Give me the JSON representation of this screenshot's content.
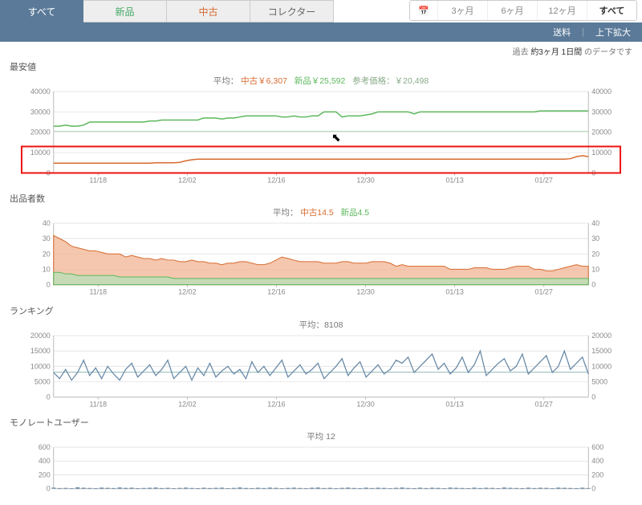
{
  "tabs": {
    "all": "すべて",
    "new": "新品",
    "used": "中古",
    "collector": "コレクター"
  },
  "range": {
    "m3": "3ヶ月",
    "m6": "6ヶ月",
    "m12": "12ヶ月",
    "all": "すべて"
  },
  "subbar": {
    "ship": "送料",
    "expand": "上下拡大"
  },
  "meta_prefix": "過去 ",
  "meta_period": "約3ヶ月 1日間",
  "meta_suffix": " のデータです",
  "x_ticks": [
    "11/18",
    "12/02",
    "12/16",
    "12/30",
    "01/13",
    "01/27"
  ],
  "charts": {
    "price": {
      "title": "最安値",
      "avg_label": "平均：",
      "used_lbl": "中古",
      "used_val": "￥6,307",
      "new_lbl": "新品",
      "new_val": "￥25,592",
      "ref_lbl": "参考価格：",
      "ref_val": "￥20,498",
      "y_ticks": [
        "0",
        "10000",
        "20000",
        "30000",
        "40000"
      ]
    },
    "sellers": {
      "title": "出品者数",
      "avg_label": "平均：",
      "used_lbl": "中古",
      "used_val": "14.5",
      "new_lbl": "新品",
      "new_val": "4.5",
      "y_ticks": [
        "0",
        "10",
        "20",
        "30",
        "40"
      ]
    },
    "rank": {
      "title": "ランキング",
      "avg_label": "平均：",
      "avg_val": "8108",
      "y_ticks": [
        "0",
        "5000",
        "10000",
        "15000",
        "20000"
      ]
    },
    "users": {
      "title": "モノレートユーザー",
      "avg_label": "平均",
      "avg_val": "12",
      "y_ticks": [
        "0",
        "200",
        "400",
        "600"
      ]
    }
  },
  "chart_data": [
    {
      "type": "line",
      "title": "最安値",
      "x": [
        0,
        1,
        2,
        3,
        4,
        5,
        6,
        7,
        8,
        9,
        10,
        11,
        12,
        13,
        14,
        15,
        16,
        17,
        18,
        19,
        20,
        21,
        22,
        23,
        24,
        25,
        26,
        27,
        28,
        29,
        30,
        31,
        32,
        33,
        34,
        35,
        36,
        37,
        38,
        39,
        40,
        41,
        42,
        43,
        44,
        45,
        46,
        47,
        48,
        49,
        50,
        51,
        52,
        53,
        54,
        55,
        56,
        57,
        58,
        59,
        60,
        61,
        62,
        63,
        64,
        65,
        66,
        67,
        68,
        69,
        70,
        71,
        72,
        73,
        74,
        75,
        76,
        77,
        78,
        79,
        80,
        81,
        82,
        83,
        84,
        85,
        86,
        87,
        88,
        89
      ],
      "x_tick_labels": [
        "11/18",
        "12/02",
        "12/16",
        "12/30",
        "01/13",
        "01/27"
      ],
      "ylim": [
        0,
        40000
      ],
      "series": [
        {
          "name": "新品",
          "color": "#5cb85c",
          "values": [
            23000,
            23000,
            23500,
            23000,
            23000,
            23500,
            25000,
            25000,
            25000,
            25000,
            25000,
            25000,
            25000,
            25000,
            25000,
            25000,
            25500,
            25500,
            26000,
            26000,
            26000,
            26000,
            26000,
            26000,
            26000,
            27000,
            27000,
            27000,
            26500,
            27000,
            27000,
            27500,
            28000,
            28000,
            28000,
            28000,
            28000,
            28000,
            27500,
            27500,
            28000,
            27500,
            27500,
            28000,
            28000,
            30000,
            30000,
            30000,
            27500,
            28000,
            28000,
            28000,
            28500,
            29000,
            30000,
            30000,
            30000,
            30000,
            30000,
            30000,
            29000,
            30000,
            30000,
            30000,
            30000,
            30000,
            30000,
            30000,
            30000,
            30000,
            30000,
            30000,
            30000,
            30000,
            30000,
            30000,
            30000,
            30000,
            30000,
            30000,
            30000,
            30500,
            30500,
            30500,
            30500,
            30500,
            30500,
            30500,
            30500,
            30500
          ]
        },
        {
          "name": "中古",
          "color": "#d86a2f",
          "values": [
            4800,
            4800,
            4800,
            4800,
            4800,
            4800,
            4800,
            4800,
            4800,
            4800,
            4800,
            4800,
            4800,
            4800,
            4800,
            4800,
            4800,
            5000,
            5000,
            5000,
            5000,
            5200,
            6000,
            6500,
            6800,
            6800,
            6800,
            6800,
            6800,
            6800,
            6800,
            6800,
            6800,
            6800,
            6800,
            6800,
            6800,
            6800,
            6800,
            6800,
            6800,
            6800,
            6800,
            6800,
            6800,
            6800,
            6800,
            6800,
            6800,
            6800,
            6800,
            6800,
            6800,
            6800,
            6800,
            6800,
            6800,
            6800,
            6800,
            6800,
            6800,
            6800,
            6800,
            6800,
            6800,
            6800,
            6800,
            6800,
            6800,
            6800,
            6800,
            6800,
            6800,
            6800,
            6800,
            6800,
            6800,
            6800,
            6800,
            6800,
            6800,
            6800,
            6800,
            6800,
            6800,
            6800,
            7000,
            8000,
            8500,
            8000
          ]
        },
        {
          "name": "参考価格",
          "color": "#9c9",
          "values": [
            20498,
            20498,
            20498,
            20498,
            20498,
            20498,
            20498,
            20498,
            20498,
            20498,
            20498,
            20498,
            20498,
            20498,
            20498,
            20498,
            20498,
            20498,
            20498,
            20498,
            20498,
            20498,
            20498,
            20498,
            20498,
            20498,
            20498,
            20498,
            20498,
            20498,
            20498,
            20498,
            20498,
            20498,
            20498,
            20498,
            20498,
            20498,
            20498,
            20498,
            20498,
            20498,
            20498,
            20498,
            20498,
            20498,
            20498,
            20498,
            20498,
            20498,
            20498,
            20498,
            20498,
            20498,
            20498,
            20498,
            20498,
            20498,
            20498,
            20498,
            20498,
            20498,
            20498,
            20498,
            20498,
            20498,
            20498,
            20498,
            20498,
            20498,
            20498,
            20498,
            20498,
            20498,
            20498,
            20498,
            20498,
            20498,
            20498,
            20498,
            20498,
            20498,
            20498,
            20498,
            20498,
            20498,
            20498,
            20498,
            20498,
            20498
          ]
        }
      ]
    },
    {
      "type": "area",
      "title": "出品者数",
      "x_tick_labels": [
        "11/18",
        "12/02",
        "12/16",
        "12/30",
        "01/13",
        "01/27"
      ],
      "ylim": [
        0,
        40
      ],
      "series": [
        {
          "name": "中古",
          "color": "#e8a07a",
          "values": [
            32,
            30,
            28,
            25,
            24,
            23,
            22,
            22,
            21,
            20,
            20,
            20,
            18,
            19,
            18,
            17,
            17,
            16,
            17,
            16,
            16,
            15,
            15,
            16,
            15,
            15,
            14,
            14,
            13,
            14,
            14,
            15,
            15,
            14,
            13,
            13,
            14,
            16,
            18,
            17,
            16,
            15,
            15,
            15,
            15,
            14,
            14,
            14,
            15,
            15,
            14,
            14,
            14,
            15,
            15,
            15,
            14,
            12,
            13,
            12,
            12,
            12,
            12,
            12,
            12,
            12,
            10,
            10,
            10,
            10,
            11,
            11,
            11,
            10,
            10,
            10,
            11,
            12,
            12,
            12,
            10,
            10,
            9,
            9,
            10,
            11,
            12,
            13,
            12,
            12
          ]
        },
        {
          "name": "新品",
          "color": "#9ed29e",
          "values": [
            8,
            8,
            7,
            7,
            6,
            6,
            6,
            6,
            6,
            6,
            6,
            5,
            5,
            5,
            5,
            5,
            5,
            5,
            5,
            5,
            4,
            4,
            4,
            4,
            4,
            4,
            4,
            4,
            4,
            4,
            4,
            4,
            4,
            4,
            4,
            4,
            4,
            4,
            4,
            4,
            4,
            4,
            4,
            4,
            4,
            4,
            4,
            4,
            4,
            4,
            4,
            4,
            4,
            4,
            4,
            4,
            4,
            4,
            4,
            4,
            4,
            4,
            4,
            4,
            4,
            4,
            4,
            4,
            4,
            4,
            4,
            4,
            4,
            4,
            4,
            4,
            4,
            4,
            4,
            4,
            4,
            4,
            4,
            4,
            4,
            4,
            4,
            4,
            4,
            4
          ]
        }
      ]
    },
    {
      "type": "line",
      "title": "ランキング",
      "x_tick_labels": [
        "11/18",
        "12/02",
        "12/16",
        "12/30",
        "01/13",
        "01/27"
      ],
      "ylim": [
        0,
        20000
      ],
      "series": [
        {
          "name": "rank",
          "color": "#6a8ba8",
          "values": [
            8000,
            6000,
            9000,
            5500,
            8000,
            12000,
            7000,
            9500,
            6000,
            10000,
            7500,
            5500,
            9000,
            11000,
            6500,
            8500,
            10500,
            7000,
            9000,
            12000,
            6000,
            8000,
            10000,
            5500,
            9500,
            7000,
            11000,
            6500,
            8500,
            10000,
            7500,
            9000,
            6000,
            11500,
            8000,
            10000,
            7000,
            9500,
            12000,
            6500,
            8500,
            10500,
            7500,
            9000,
            11000,
            6000,
            8000,
            10000,
            12500,
            7000,
            9500,
            11500,
            6500,
            8500,
            10500,
            7500,
            9000,
            12000,
            11000,
            13000,
            8000,
            10000,
            12000,
            14000,
            9000,
            11000,
            7500,
            9500,
            13000,
            8000,
            10500,
            15000,
            7000,
            9000,
            11000,
            12500,
            8500,
            10000,
            14000,
            7500,
            9500,
            11500,
            13500,
            8000,
            10000,
            15000,
            9000,
            11000,
            13000,
            7500
          ]
        }
      ],
      "avg_line": 8108
    },
    {
      "type": "bar",
      "title": "モノレートユーザー",
      "x_tick_labels": [
        "11/18",
        "12/02",
        "12/16",
        "12/30",
        "01/13",
        "01/27"
      ],
      "ylim": [
        0,
        600
      ],
      "series": [
        {
          "name": "users",
          "color": "#6a8ba8",
          "values": [
            15,
            10,
            12,
            8,
            20,
            14,
            11,
            9,
            16,
            13,
            10,
            18,
            12,
            15,
            9,
            11,
            14,
            17,
            10,
            13,
            8,
            12,
            16,
            11,
            9,
            14,
            10,
            13,
            15,
            8,
            12,
            18,
            11,
            9,
            14,
            10,
            16,
            13,
            8,
            12,
            15,
            11,
            9,
            14,
            17,
            10,
            13,
            8,
            12,
            16,
            11,
            9,
            15,
            10,
            14,
            12,
            8,
            13,
            17,
            11,
            9,
            15,
            10,
            14,
            12,
            8,
            16,
            13,
            11,
            9,
            15,
            10,
            14,
            12,
            8,
            17,
            13,
            11,
            9,
            15,
            10,
            14,
            12,
            8,
            16,
            13,
            11,
            9,
            15,
            10
          ]
        }
      ]
    }
  ]
}
